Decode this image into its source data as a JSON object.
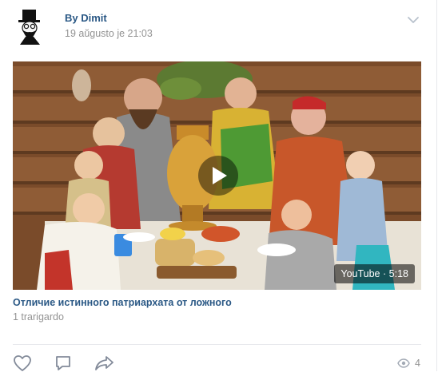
{
  "post": {
    "author": "By Dimit",
    "date": "19 aŭgusto je 21:03"
  },
  "video": {
    "source_label": "YouTube",
    "separator": "·",
    "duration": "5:18",
    "title": "Отличие истинного патриархата от ложного",
    "views_text": "1 trarigardo"
  },
  "footer": {
    "view_count": "4"
  },
  "icons": {
    "menu": "chevron-down-icon",
    "like": "heart-icon",
    "comment": "comment-icon",
    "share": "share-icon",
    "views": "eye-icon",
    "play": "play-icon"
  },
  "colors": {
    "link": "#2a5885",
    "muted": "#939393",
    "divider": "#e7e8ec",
    "icon": "#828a99"
  }
}
